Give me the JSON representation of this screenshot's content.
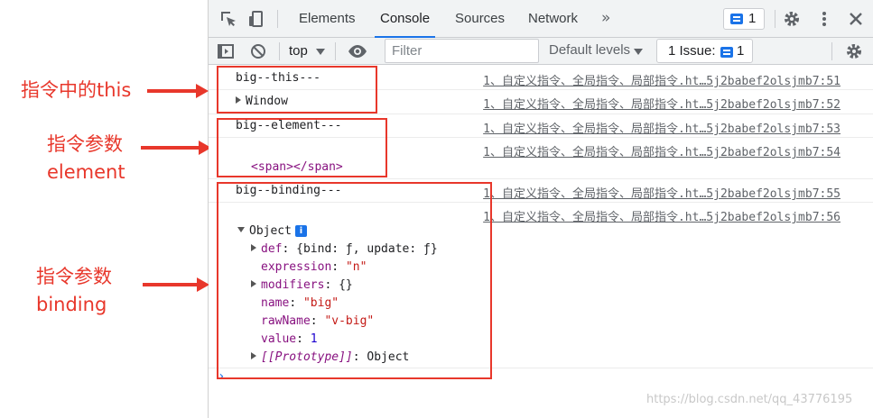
{
  "annotations": {
    "this": "指令中的this",
    "element_line1": "指令参数",
    "element_line2": "element",
    "binding_line1": "指令参数",
    "binding_line2": "binding"
  },
  "devtools": {
    "tabs": [
      {
        "label": "Elements",
        "active": false
      },
      {
        "label": "Console",
        "active": true
      },
      {
        "label": "Sources",
        "active": false
      },
      {
        "label": "Network",
        "active": false
      }
    ],
    "more_tabs": "»",
    "issue_count": "1",
    "icons": [
      "inspect-icon",
      "device-toggle-icon",
      "more-tabs-icon",
      "issues-icon",
      "settings-gear-icon",
      "kebab-menu-icon",
      "close-icon",
      "sidebar-toggle-icon",
      "clear-console-icon",
      "eye-icon"
    ],
    "accent": "#1a73e8"
  },
  "toolbar": {
    "context": "top",
    "filter_placeholder": "Filter",
    "levels": "Default levels",
    "issues_label": "1 Issue:",
    "issues_count": "1"
  },
  "console": {
    "lines": [
      {
        "text": "big--this---",
        "source": "1、自定义指令、全局指令、局部指令.ht…5j2babef2olsjmb7:51"
      },
      {
        "text": "Window",
        "source": "1、自定义指令、全局指令、局部指令.ht…5j2babef2olsjmb7:52"
      },
      {
        "text": "big--element---",
        "source": "1、自定义指令、全局指令、局部指令.ht…5j2babef2olsjmb7:53"
      },
      {
        "text": "",
        "source": "1、自定义指令、全局指令、局部指令.ht…5j2babef2olsjmb7:54"
      },
      {
        "text": "big--binding---",
        "source": "1、自定义指令、全局指令、局部指令.ht…5j2babef2olsjmb7:55"
      },
      {
        "text": "",
        "source": "1、自定义指令、全局指令、局部指令.ht…5j2babef2olsjmb7:56"
      }
    ],
    "element_html": "<span></span>",
    "object": {
      "label": "Object",
      "info": "i",
      "def_key": "def",
      "def_value": "{bind: ƒ, update: ƒ}",
      "expression_key": "expression",
      "expression_value": "\"n\"",
      "modifiers_key": "modifiers",
      "modifiers_value": "{}",
      "name_key": "name",
      "name_value": "\"big\"",
      "rawName_key": "rawName",
      "rawName_value": "\"v-big\"",
      "value_key": "value",
      "value_value": "1",
      "proto_key": "[[Prototype]]",
      "proto_value": "Object"
    },
    "prompt": "›"
  },
  "watermark": "https://blog.csdn.net/qq_43776195",
  "colors": {
    "annotation_red": "#e8372b"
  }
}
